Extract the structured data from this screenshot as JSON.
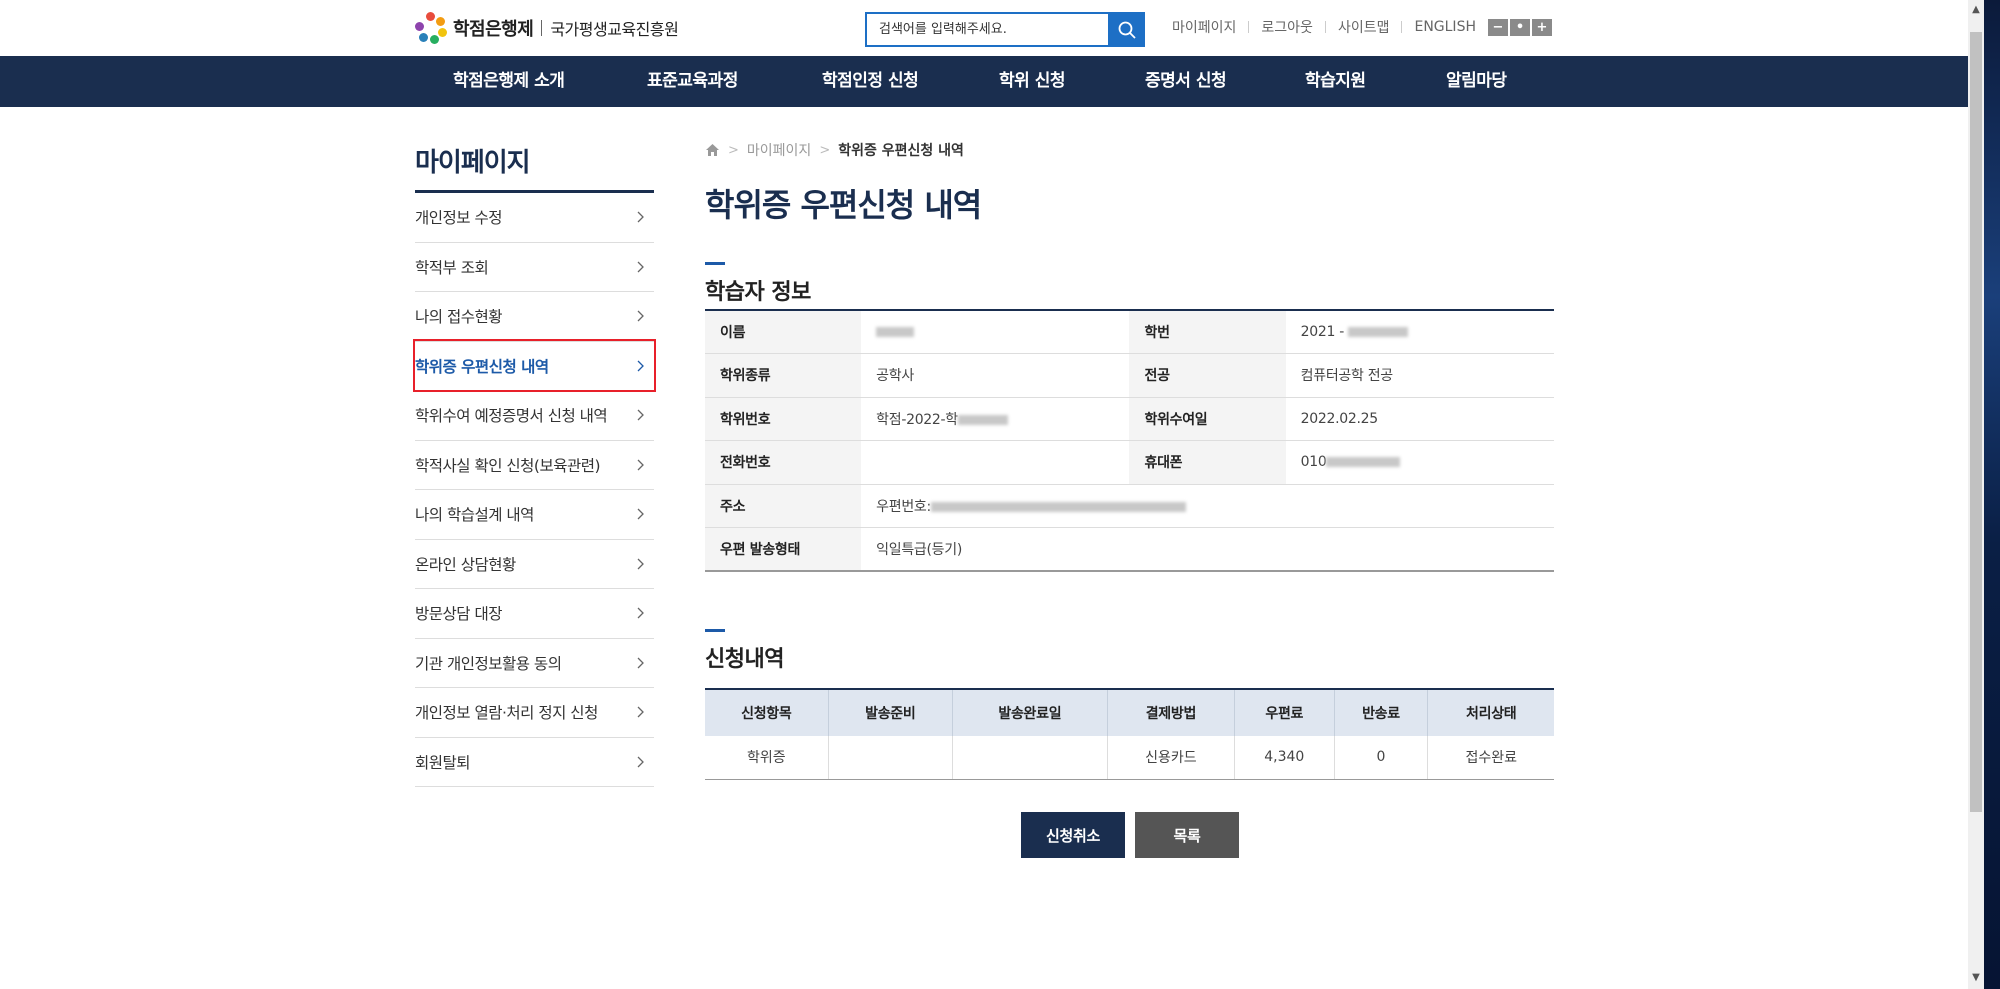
{
  "header": {
    "logo_main": "학점은행제",
    "logo_sub": "국가평생교육진흥원",
    "search_placeholder": "검색어를 입력해주세요.",
    "util_links": [
      "마이페이지",
      "로그아웃",
      "사이트맵",
      "ENGLISH"
    ],
    "font_buttons": [
      "−",
      "•",
      "+"
    ]
  },
  "nav": {
    "items": [
      "학점은행제 소개",
      "표준교육과정",
      "학점인정 신청",
      "학위 신청",
      "증명서 신청",
      "학습지원",
      "알림마당"
    ]
  },
  "sidebar": {
    "title": "마이페이지",
    "items": [
      {
        "label": "개인정보 수정",
        "active": false
      },
      {
        "label": "학적부 조회",
        "active": false
      },
      {
        "label": "나의 접수현황",
        "active": false
      },
      {
        "label": "학위증 우편신청 내역",
        "active": true
      },
      {
        "label": "학위수여 예정증명서 신청 내역",
        "active": false
      },
      {
        "label": "학적사실 확인 신청(보육관련)",
        "active": false
      },
      {
        "label": "나의 학습설계 내역",
        "active": false
      },
      {
        "label": "온라인 상담현황",
        "active": false
      },
      {
        "label": "방문상담 대장",
        "active": false
      },
      {
        "label": "기관 개인정보활용 동의",
        "active": false
      },
      {
        "label": "개인정보 열람·처리 정지 신청",
        "active": false
      },
      {
        "label": "회원탈퇴",
        "active": false
      }
    ]
  },
  "breadcrumb": {
    "parent": "마이페이지",
    "current": "학위증 우편신청 내역"
  },
  "page_title": "학위증 우편신청 내역",
  "learner_info": {
    "title": "학습자 정보",
    "labels": {
      "name": "이름",
      "student_no": "학번",
      "degree_type": "학위종류",
      "major": "전공",
      "degree_no": "학위번호",
      "degree_date": "학위수여일",
      "phone": "전화번호",
      "mobile": "휴대폰",
      "address": "주소",
      "mail_type": "우편 발송형태"
    },
    "values": {
      "student_no_prefix": "2021 -",
      "degree_type": "공학사",
      "major": "컴퓨터공학 전공",
      "degree_no_prefix": "학점-2022-학",
      "degree_date": "2022.02.25",
      "mobile_prefix": "010",
      "address_prefix": "우편번호:",
      "mail_type": "익일특급(등기)"
    }
  },
  "request": {
    "title": "신청내역",
    "columns": [
      "신청항목",
      "발송준비",
      "발송완료일",
      "결제방법",
      "우편료",
      "반송료",
      "처리상태"
    ],
    "rows": [
      [
        "학위증",
        "",
        "",
        "신용카드",
        "4,340",
        "0",
        "접수완료"
      ]
    ]
  },
  "buttons": {
    "cancel": "신청취소",
    "list": "목록"
  },
  "colors": {
    "navy": "#1a2e4f",
    "accent_blue": "#1d6fc5",
    "highlight_red": "#e8202a"
  }
}
